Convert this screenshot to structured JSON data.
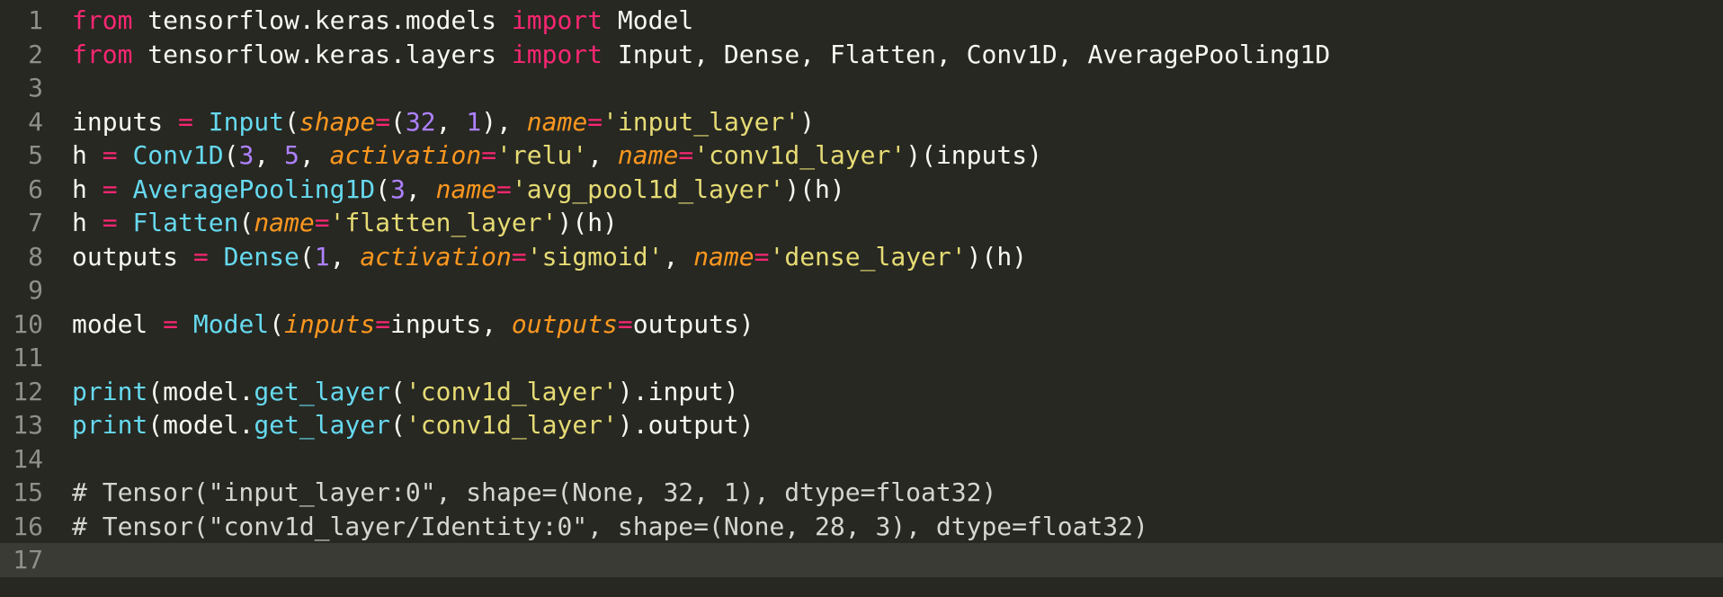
{
  "colors": {
    "background": "#272822",
    "keyword": "#f92672",
    "function": "#66d9ef",
    "number": "#ae81ff",
    "string": "#e6db74",
    "parameter": "#fd971f",
    "line_number": "#8f908a",
    "text": "#f8f8f2"
  },
  "current_line": 17,
  "lines": [
    {
      "n": "1",
      "tokens": [
        {
          "t": "kw",
          "v": "from"
        },
        {
          "t": "txt",
          "v": " tensorflow.keras.models "
        },
        {
          "t": "kw",
          "v": "import"
        },
        {
          "t": "txt",
          "v": " Model"
        }
      ]
    },
    {
      "n": "2",
      "tokens": [
        {
          "t": "kw",
          "v": "from"
        },
        {
          "t": "txt",
          "v": " tensorflow.keras.layers "
        },
        {
          "t": "kw",
          "v": "import"
        },
        {
          "t": "txt",
          "v": " Input, Dense, Flatten, Conv1D, AveragePooling1D"
        }
      ]
    },
    {
      "n": "3",
      "tokens": []
    },
    {
      "n": "4",
      "tokens": [
        {
          "t": "txt",
          "v": "inputs "
        },
        {
          "t": "op",
          "v": "="
        },
        {
          "t": "txt",
          "v": " "
        },
        {
          "t": "fn",
          "v": "Input"
        },
        {
          "t": "txt",
          "v": "("
        },
        {
          "t": "arg",
          "v": "shape"
        },
        {
          "t": "op",
          "v": "="
        },
        {
          "t": "txt",
          "v": "("
        },
        {
          "t": "num",
          "v": "32"
        },
        {
          "t": "txt",
          "v": ", "
        },
        {
          "t": "num",
          "v": "1"
        },
        {
          "t": "txt",
          "v": "), "
        },
        {
          "t": "arg",
          "v": "name"
        },
        {
          "t": "op",
          "v": "="
        },
        {
          "t": "str",
          "v": "'input_layer'"
        },
        {
          "t": "txt",
          "v": ")"
        }
      ]
    },
    {
      "n": "5",
      "tokens": [
        {
          "t": "txt",
          "v": "h "
        },
        {
          "t": "op",
          "v": "="
        },
        {
          "t": "txt",
          "v": " "
        },
        {
          "t": "fn",
          "v": "Conv1D"
        },
        {
          "t": "txt",
          "v": "("
        },
        {
          "t": "num",
          "v": "3"
        },
        {
          "t": "txt",
          "v": ", "
        },
        {
          "t": "num",
          "v": "5"
        },
        {
          "t": "txt",
          "v": ", "
        },
        {
          "t": "arg",
          "v": "activation"
        },
        {
          "t": "op",
          "v": "="
        },
        {
          "t": "str",
          "v": "'relu'"
        },
        {
          "t": "txt",
          "v": ", "
        },
        {
          "t": "arg",
          "v": "name"
        },
        {
          "t": "op",
          "v": "="
        },
        {
          "t": "str",
          "v": "'conv1d_layer'"
        },
        {
          "t": "txt",
          "v": ")(inputs)"
        }
      ]
    },
    {
      "n": "6",
      "tokens": [
        {
          "t": "txt",
          "v": "h "
        },
        {
          "t": "op",
          "v": "="
        },
        {
          "t": "txt",
          "v": " "
        },
        {
          "t": "fn",
          "v": "AveragePooling1D"
        },
        {
          "t": "txt",
          "v": "("
        },
        {
          "t": "num",
          "v": "3"
        },
        {
          "t": "txt",
          "v": ", "
        },
        {
          "t": "arg",
          "v": "name"
        },
        {
          "t": "op",
          "v": "="
        },
        {
          "t": "str",
          "v": "'avg_pool1d_layer'"
        },
        {
          "t": "txt",
          "v": ")(h)"
        }
      ]
    },
    {
      "n": "7",
      "tokens": [
        {
          "t": "txt",
          "v": "h "
        },
        {
          "t": "op",
          "v": "="
        },
        {
          "t": "txt",
          "v": " "
        },
        {
          "t": "fn",
          "v": "Flatten"
        },
        {
          "t": "txt",
          "v": "("
        },
        {
          "t": "arg",
          "v": "name"
        },
        {
          "t": "op",
          "v": "="
        },
        {
          "t": "str",
          "v": "'flatten_layer'"
        },
        {
          "t": "txt",
          "v": ")(h)"
        }
      ]
    },
    {
      "n": "8",
      "tokens": [
        {
          "t": "txt",
          "v": "outputs "
        },
        {
          "t": "op",
          "v": "="
        },
        {
          "t": "txt",
          "v": " "
        },
        {
          "t": "fn",
          "v": "Dense"
        },
        {
          "t": "txt",
          "v": "("
        },
        {
          "t": "num",
          "v": "1"
        },
        {
          "t": "txt",
          "v": ", "
        },
        {
          "t": "arg",
          "v": "activation"
        },
        {
          "t": "op",
          "v": "="
        },
        {
          "t": "str",
          "v": "'sigmoid'"
        },
        {
          "t": "txt",
          "v": ", "
        },
        {
          "t": "arg",
          "v": "name"
        },
        {
          "t": "op",
          "v": "="
        },
        {
          "t": "str",
          "v": "'dense_layer'"
        },
        {
          "t": "txt",
          "v": ")(h)"
        }
      ]
    },
    {
      "n": "9",
      "tokens": []
    },
    {
      "n": "10",
      "tokens": [
        {
          "t": "txt",
          "v": "model "
        },
        {
          "t": "op",
          "v": "="
        },
        {
          "t": "txt",
          "v": " "
        },
        {
          "t": "fn",
          "v": "Model"
        },
        {
          "t": "txt",
          "v": "("
        },
        {
          "t": "arg",
          "v": "inputs"
        },
        {
          "t": "op",
          "v": "="
        },
        {
          "t": "txt",
          "v": "inputs, "
        },
        {
          "t": "arg",
          "v": "outputs"
        },
        {
          "t": "op",
          "v": "="
        },
        {
          "t": "txt",
          "v": "outputs)"
        }
      ]
    },
    {
      "n": "11",
      "tokens": []
    },
    {
      "n": "12",
      "tokens": [
        {
          "t": "fn",
          "v": "print"
        },
        {
          "t": "txt",
          "v": "(model."
        },
        {
          "t": "fn",
          "v": "get_layer"
        },
        {
          "t": "txt",
          "v": "("
        },
        {
          "t": "str",
          "v": "'conv1d_layer'"
        },
        {
          "t": "txt",
          "v": ").input)"
        }
      ]
    },
    {
      "n": "13",
      "tokens": [
        {
          "t": "fn",
          "v": "print"
        },
        {
          "t": "txt",
          "v": "(model."
        },
        {
          "t": "fn",
          "v": "get_layer"
        },
        {
          "t": "txt",
          "v": "("
        },
        {
          "t": "str",
          "v": "'conv1d_layer'"
        },
        {
          "t": "txt",
          "v": ").output)"
        }
      ]
    },
    {
      "n": "14",
      "tokens": []
    },
    {
      "n": "15",
      "tokens": [
        {
          "t": "com",
          "v": "# Tensor(\"input_layer:0\", shape=(None, 32, 1), dtype=float32)"
        }
      ]
    },
    {
      "n": "16",
      "tokens": [
        {
          "t": "com",
          "v": "# Tensor(\"conv1d_layer/Identity:0\", shape=(None, 28, 3), dtype=float32)"
        }
      ]
    },
    {
      "n": "17",
      "tokens": []
    }
  ]
}
